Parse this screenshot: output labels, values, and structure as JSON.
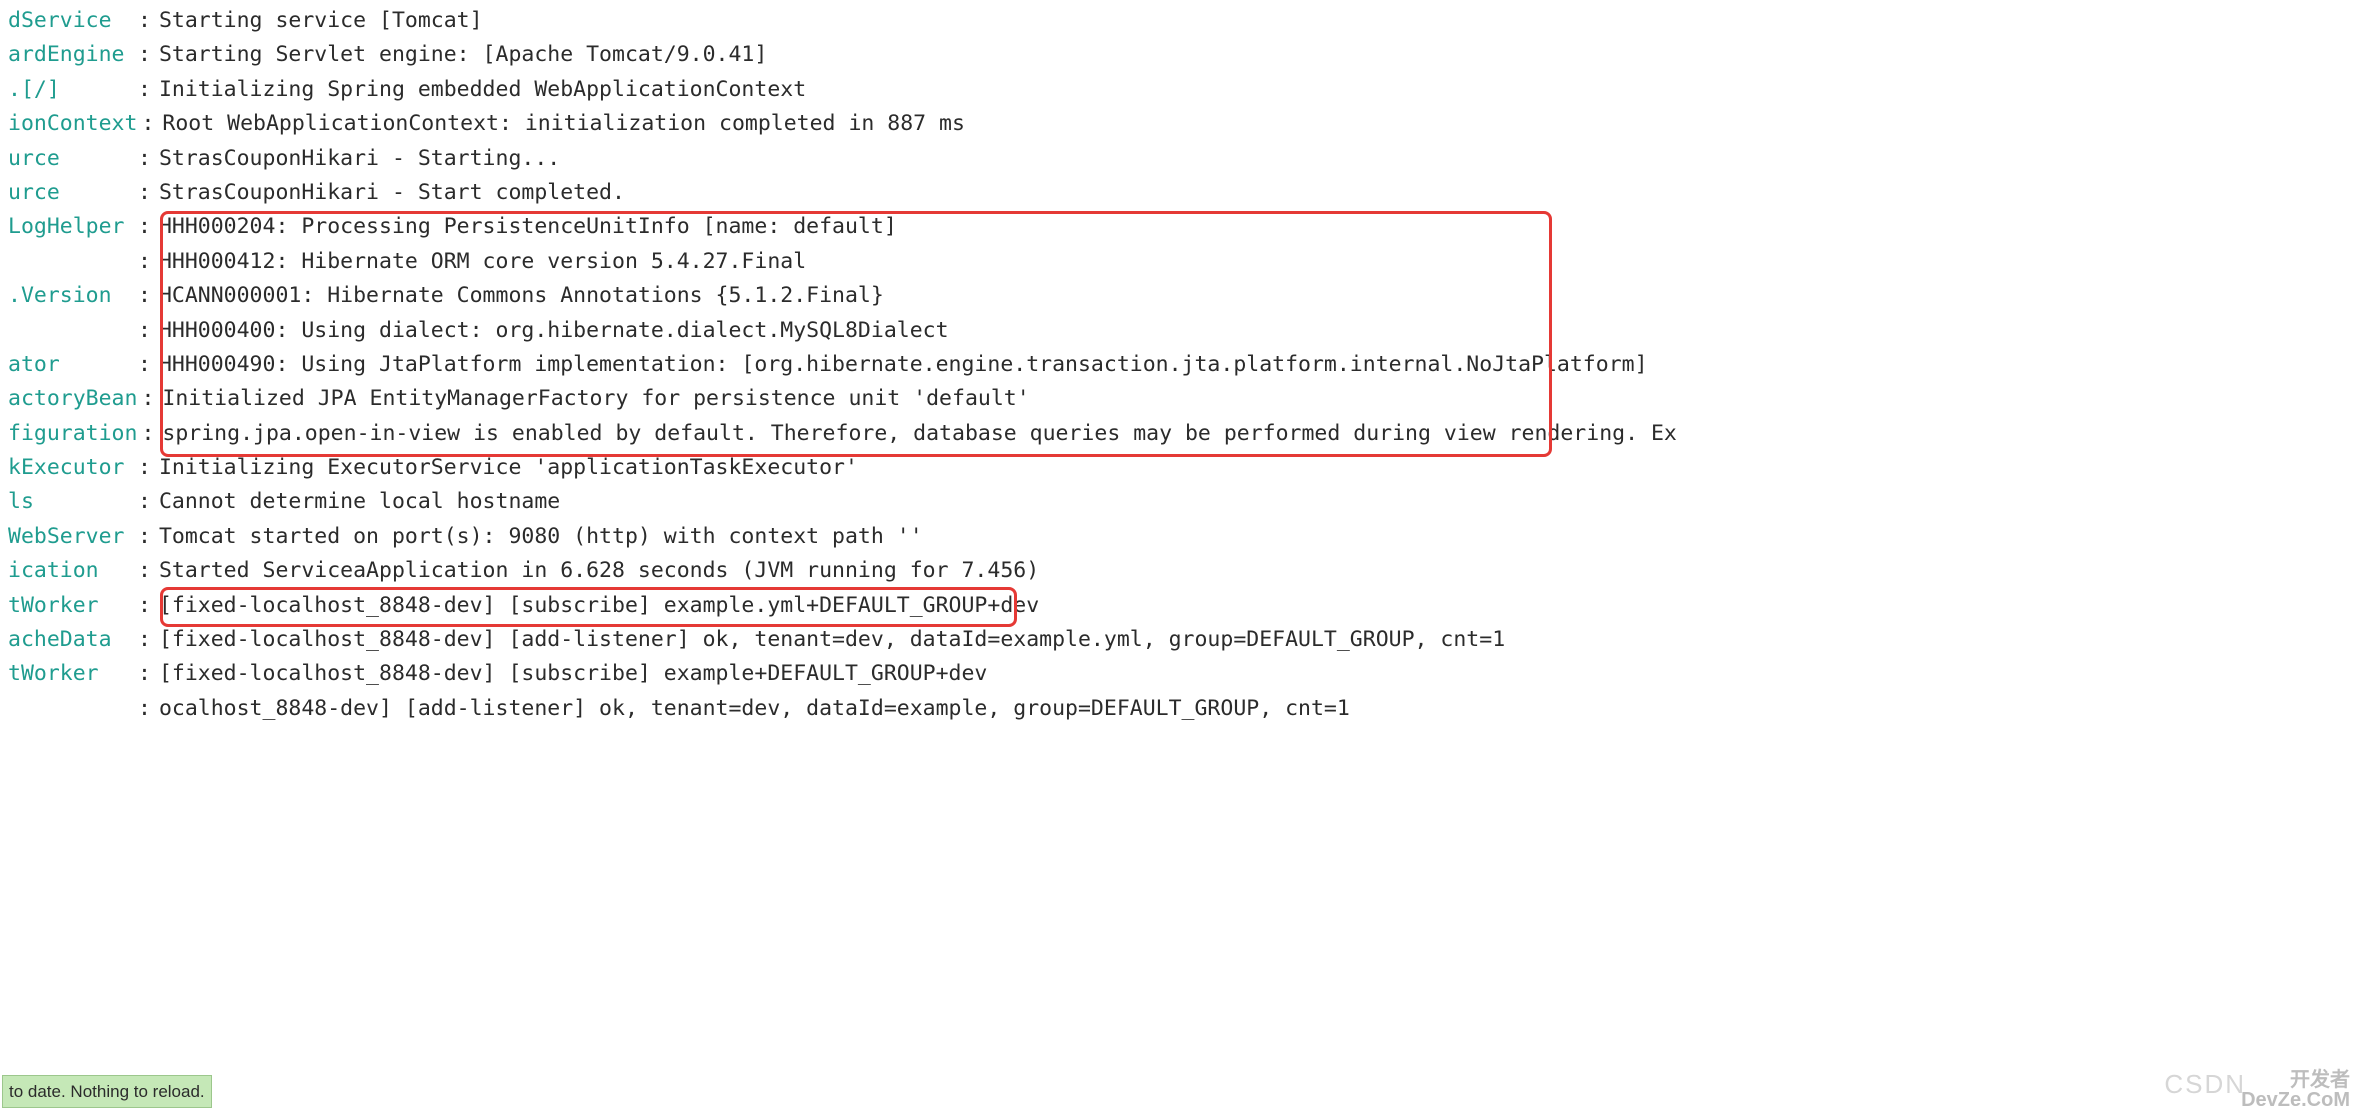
{
  "lines": [
    {
      "logger": "dService",
      "msg": "Starting service [Tomcat]"
    },
    {
      "logger": "ardEngine",
      "msg": "Starting Servlet engine: [Apache Tomcat/9.0.41]"
    },
    {
      "logger": ".[/]",
      "msg": "Initializing Spring embedded WebApplicationContext"
    },
    {
      "logger": "ionContext",
      "msg": "Root WebApplicationContext: initialization completed in 887 ms"
    },
    {
      "logger": "urce",
      "msg": "StrasCouponHikari - Starting..."
    },
    {
      "logger": "urce",
      "msg": "StrasCouponHikari - Start completed."
    },
    {
      "logger": "LogHelper",
      "msg": "HHH000204: Processing PersistenceUnitInfo [name: default]"
    },
    {
      "logger": "",
      "msg": "HHH000412: Hibernate ORM core version 5.4.27.Final"
    },
    {
      "logger": ".Version",
      "msg": "HCANN000001: Hibernate Commons Annotations {5.1.2.Final}"
    },
    {
      "logger": "",
      "msg": "HHH000400: Using dialect: org.hibernate.dialect.MySQL8Dialect"
    },
    {
      "logger": "ator",
      "msg": "HHH000490: Using JtaPlatform implementation: [org.hibernate.engine.transaction.jta.platform.internal.NoJtaPlatform]"
    },
    {
      "logger": "actoryBean",
      "msg": "Initialized JPA EntityManagerFactory for persistence unit 'default'"
    },
    {
      "logger": "figuration",
      "msg": "spring.jpa.open-in-view is enabled by default. Therefore, database queries may be performed during view rendering. Ex"
    },
    {
      "logger": "kExecutor",
      "msg": "Initializing ExecutorService 'applicationTaskExecutor'"
    },
    {
      "logger": "ls",
      "msg": "Cannot determine local hostname"
    },
    {
      "logger": "WebServer",
      "msg": "Tomcat started on port(s): 9080 (http) with context path ''"
    },
    {
      "logger": "ication",
      "msg": "Started ServiceaApplication in 6.628 seconds (JVM running for 7.456)"
    },
    {
      "logger": "tWorker",
      "msg": "[fixed-localhost_8848-dev] [subscribe] example.yml+DEFAULT_GROUP+dev"
    },
    {
      "logger": "acheData",
      "msg": "[fixed-localhost_8848-dev] [add-listener] ok, tenant=dev, dataId=example.yml, group=DEFAULT_GROUP, cnt=1"
    },
    {
      "logger": "tWorker",
      "msg": "[fixed-localhost_8848-dev] [subscribe] example+DEFAULT_GROUP+dev"
    },
    {
      "logger": "",
      "msg": "ocalhost_8848-dev] [add-listener] ok, tenant=dev, dataId=example, group=DEFAULT_GROUP, cnt=1"
    }
  ],
  "status": "to date. Nothing to reload.",
  "watermark1": "CSDN",
  "watermark2_top": "开发者",
  "watermark2_bot": "DevZe.CoM"
}
